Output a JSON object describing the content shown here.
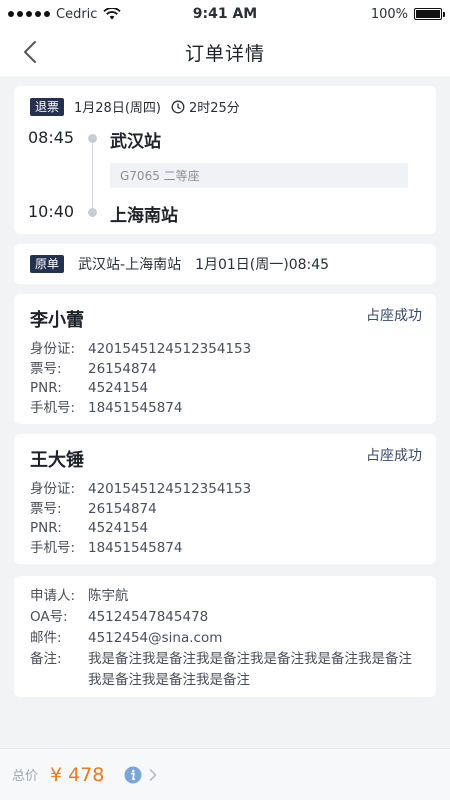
{
  "status_bar": {
    "carrier": "Cedric",
    "time": "9:41 AM",
    "battery": "100%"
  },
  "nav": {
    "title": "订单详情"
  },
  "trip": {
    "tag": "退票",
    "date": "1月28日(周四)",
    "duration": "2时25分",
    "depart_time": "08:45",
    "depart_station": "武汉站",
    "train_info": "G7065 二等座",
    "arrive_time": "10:40",
    "arrive_station": "上海南站"
  },
  "original_order": {
    "tag": "原单",
    "route": "武汉站-上海南站",
    "datetime": "1月01日(周一)08:45"
  },
  "passengers": [
    {
      "name": "李小蕾",
      "status": "占座成功",
      "id_label": "身份证:",
      "id_value": "4201545124512354153",
      "ticket_label": "票号:",
      "ticket_value": "26154874",
      "pnr_label": "PNR:",
      "pnr_value": "4524154",
      "phone_label": "手机号:",
      "phone_value": "18451545874"
    },
    {
      "name": "王大锤",
      "status": "占座成功",
      "id_label": "身份证:",
      "id_value": "4201545124512354153",
      "ticket_label": "票号:",
      "ticket_value": "26154874",
      "pnr_label": "PNR:",
      "pnr_value": "4524154",
      "phone_label": "手机号:",
      "phone_value": "18451545874"
    }
  ],
  "applicant": {
    "applicant_label": "申请人:",
    "applicant_value": "陈宇航",
    "oa_label": "OA号:",
    "oa_value": "45124547845478",
    "email_label": "邮件:",
    "email_value": "4512454@sina.com",
    "remark_label": "备注:",
    "remark_value": "我是备注我是备注我是备注我是备注我是备注我是备注我是备注我是备注我是备注"
  },
  "bottom_bar": {
    "total_label": "总价",
    "total_amount": "¥ 478"
  },
  "colors": {
    "tag_bg": "#24314f",
    "price": "#f0781e",
    "info_icon": "#7aa6d9"
  }
}
